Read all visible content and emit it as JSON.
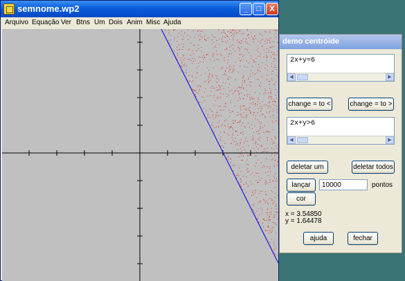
{
  "window": {
    "title": "semnome.wp2",
    "controls": {
      "minimize": "_",
      "maximize": "□",
      "close": "X"
    }
  },
  "menu": [
    "Arquivo",
    "Equação",
    "Ver",
    "Btns",
    "Um",
    "Dois",
    "Anim",
    "Misc",
    "Ajuda"
  ],
  "graph": {
    "line_equation": "2x+y=6",
    "inequality": "2x+y>6",
    "x_range": [
      -10,
      10
    ],
    "y_range": [
      -10,
      10
    ],
    "point_color": "#e03020",
    "line_color": "#1a1ae0",
    "background": "#c0c0c0",
    "sample_points": 10000
  },
  "dialog": {
    "title": "demo centróide",
    "equation1": "2x+y=6",
    "button_left": "change = to <",
    "button_right": "change = to >",
    "equation2": "2x+y>6",
    "delete_one": "deletar um",
    "delete_all": "deletar todos",
    "launch": "lançar",
    "points_value": "10000",
    "points_label": "pontos",
    "color": "cor",
    "x_result": "x = 3.54850",
    "y_result": "y = 1.64478",
    "help": "ajuda",
    "close": "fechar"
  }
}
